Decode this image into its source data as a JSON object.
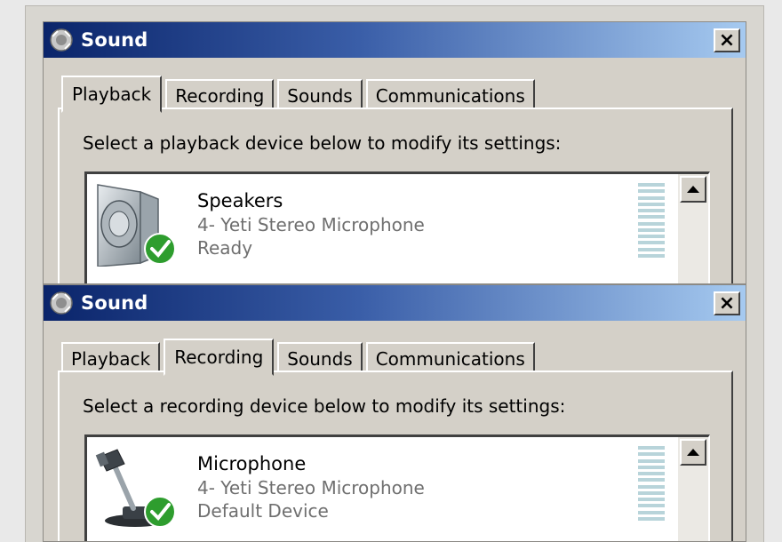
{
  "windows": [
    {
      "title": "Sound",
      "close_label": "×",
      "tabs": [
        "Playback",
        "Recording",
        "Sounds",
        "Communications"
      ],
      "active_tab": "Playback",
      "instruction": "Select a playback device below to modify its settings:",
      "device": {
        "name": "Speakers",
        "subtitle": "4- Yeti Stereo Microphone",
        "status": "Ready",
        "icon": "speaker-icon"
      }
    },
    {
      "title": "Sound",
      "close_label": "×",
      "tabs": [
        "Playback",
        "Recording",
        "Sounds",
        "Communications"
      ],
      "active_tab": "Recording",
      "instruction": "Select a recording device below to modify its settings:",
      "device": {
        "name": "Microphone",
        "subtitle": "4- Yeti Stereo Microphone",
        "status": "Default Device",
        "icon": "microphone-icon"
      }
    }
  ],
  "colors": {
    "titlebar_start": "#0a246a",
    "titlebar_end": "#a6caf0",
    "check_green": "#2e9d2e",
    "level_meter": "#b8d4da"
  }
}
